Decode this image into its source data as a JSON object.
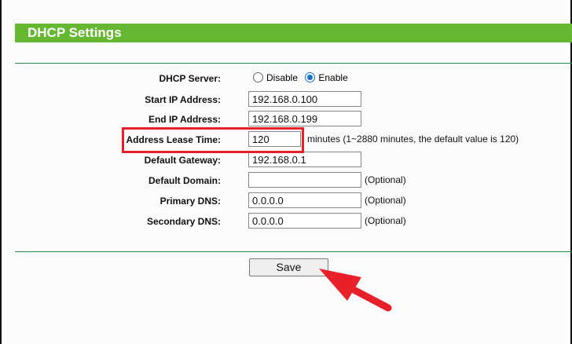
{
  "section_title": "DHCP Settings",
  "dhcp_server": {
    "label": "DHCP Server:",
    "disable": "Disable",
    "enable": "Enable",
    "selected": "Enable"
  },
  "fields": [
    {
      "label": "Start IP Address:",
      "value": "192.168.0.100"
    },
    {
      "label": "End IP Address:",
      "value": "192.168.0.199"
    },
    {
      "label": "Address Lease Time:",
      "value": "120",
      "note": "minutes (1~2880 minutes, the default value is 120)"
    },
    {
      "label": "Default Gateway:",
      "value": "192.168.0.1"
    },
    {
      "label": "Default Domain:",
      "value": "",
      "note": "(Optional)"
    },
    {
      "label": "Primary DNS:",
      "value": "0.0.0.0",
      "note": "(Optional)"
    },
    {
      "label": "Secondary DNS:",
      "value": "0.0.0.0",
      "note": "(Optional)"
    }
  ],
  "save_label": "Save",
  "annotation_color": "#e8202a"
}
